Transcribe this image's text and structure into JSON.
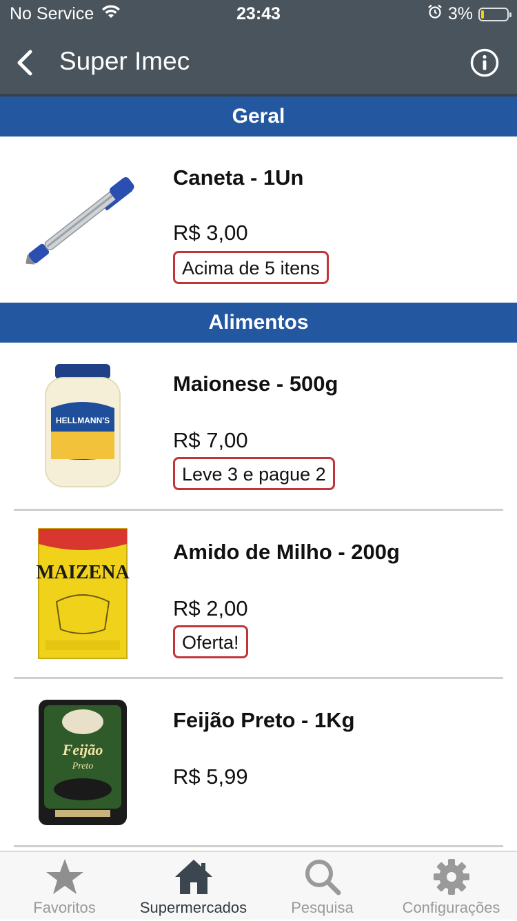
{
  "status_bar": {
    "carrier": "No Service",
    "time": "23:43",
    "battery": "3%",
    "battery_level": 0.03
  },
  "nav": {
    "title": "Super Imec",
    "back_icon": "chevron-left-icon",
    "info_icon": "info-icon"
  },
  "sections": [
    {
      "title": "Geral",
      "products": [
        {
          "name": "Caneta - 1Un",
          "price": "R$ 3,00",
          "badge": "Acima de 5 itens",
          "image": "pen-icon"
        }
      ]
    },
    {
      "title": "Alimentos",
      "products": [
        {
          "name": "Maionese - 500g",
          "price": "R$ 7,00",
          "badge": "Leve 3 e pague 2",
          "image": "mayonnaise-jar-icon"
        },
        {
          "name": "Amido de Milho - 200g",
          "price": "R$ 2,00",
          "badge": "Oferta!",
          "image": "cornstarch-box-icon"
        },
        {
          "name": "Feijão Preto - 1Kg",
          "price": "R$ 5,99",
          "badge": "",
          "image": "black-beans-bag-icon"
        }
      ]
    }
  ],
  "tabbar": {
    "active": "Supermercados",
    "tabs": [
      {
        "label": "Favoritos",
        "icon": "star-icon"
      },
      {
        "label": "Supermercados",
        "icon": "home-icon"
      },
      {
        "label": "Pesquisa",
        "icon": "search-icon"
      },
      {
        "label": "Configurações",
        "icon": "gear-icon"
      }
    ]
  },
  "colors": {
    "header_bg": "#4a545c",
    "section_bg": "#2357a0",
    "badge_border": "#c0353a",
    "tab_active": "#333a40",
    "tab_inactive": "#9a9a9a"
  }
}
